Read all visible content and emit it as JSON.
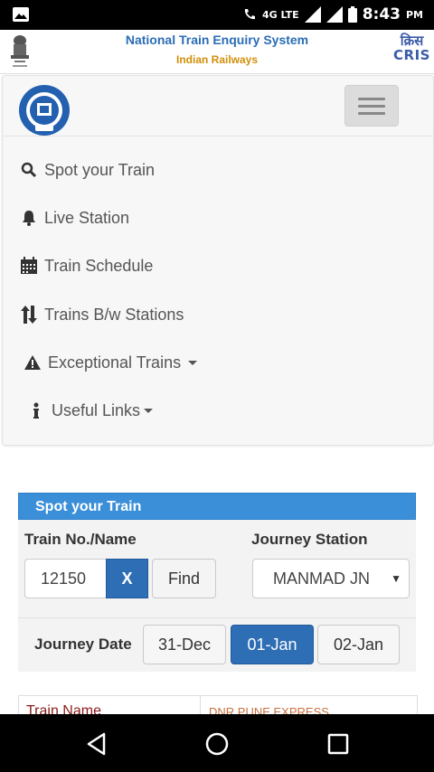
{
  "status_bar": {
    "network": "4G LTE",
    "time": "8:43",
    "ampm": "PM"
  },
  "header": {
    "title": "National Train Enquiry System",
    "subtitle": "Indian Railways",
    "cris_hindi": "क्रिस",
    "cris_en": "CRIS"
  },
  "nav": {
    "items": [
      {
        "label": "Spot your Train",
        "icon": "search-icon"
      },
      {
        "label": "Live Station",
        "icon": "bell-icon"
      },
      {
        "label": "Train Schedule",
        "icon": "calendar-icon"
      },
      {
        "label": "Trains B/w Stations",
        "icon": "swap-vertical-icon"
      },
      {
        "label": "Exceptional Trains",
        "icon": "warning-icon"
      },
      {
        "label": "Useful Links",
        "icon": "info-icon"
      }
    ]
  },
  "panel": {
    "title": "Spot your Train",
    "train_label": "Train No./Name",
    "train_value": "12150",
    "clear_label": "X",
    "find_label": "Find",
    "station_label": "Journey Station",
    "station_value": "MANMAD JN",
    "date_label": "Journey Date",
    "dates": [
      "31-Dec",
      "01-Jan",
      "02-Jan"
    ],
    "selected_date": "01-Jan"
  },
  "table": {
    "col1": "Train Name",
    "col2": "DNR PUNE EXPRESS"
  },
  "colors": {
    "accent": "#3a8fd8",
    "primary_button": "#2e6eb5",
    "header_title": "#2a6db5",
    "header_sub": "#d18f0a"
  }
}
